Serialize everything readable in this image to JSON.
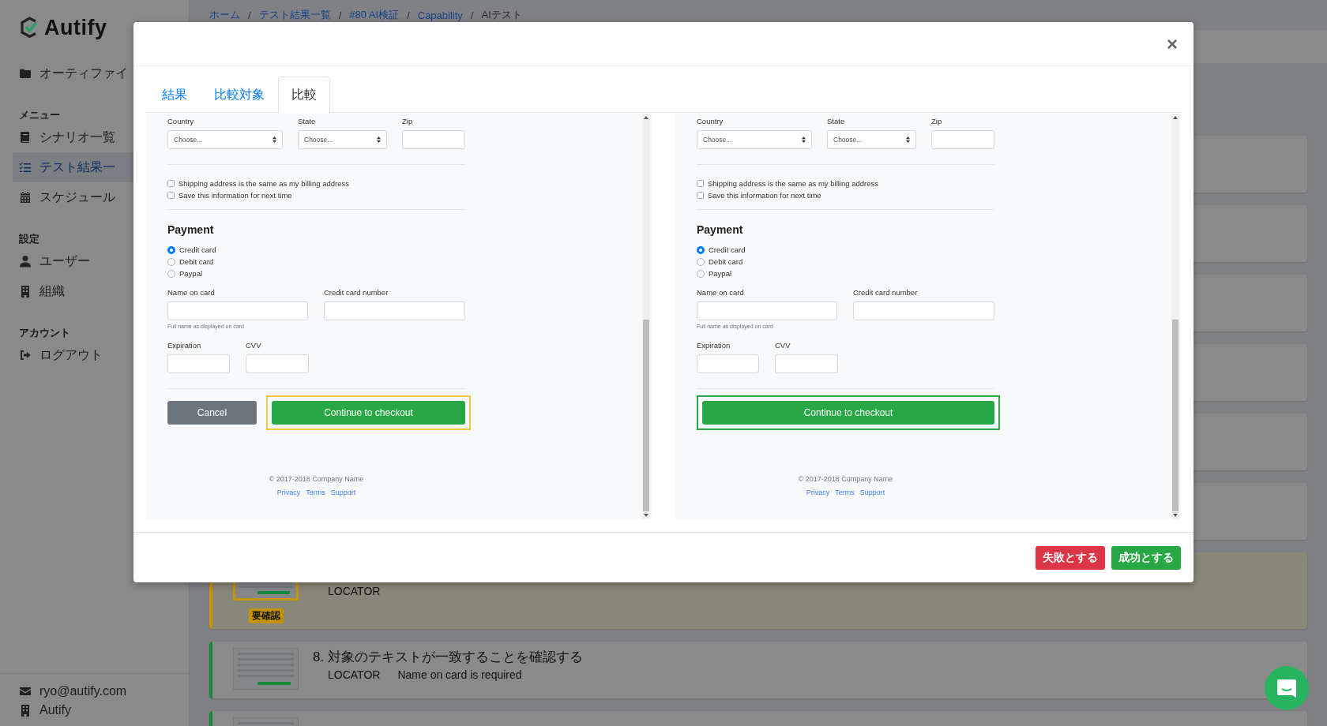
{
  "sidebar": {
    "logo": "Autify",
    "project": "オーティファイ",
    "sections": [
      {
        "heading": "メニュー",
        "items": [
          {
            "label": "シナリオ一覧",
            "selected": false
          },
          {
            "label": "テスト結果一",
            "selected": true
          },
          {
            "label": "スケジュール",
            "selected": false
          }
        ]
      },
      {
        "heading": "設定",
        "items": [
          {
            "label": "ユーザー",
            "selected": false
          },
          {
            "label": "組織",
            "selected": false
          }
        ]
      },
      {
        "heading": "アカウント",
        "items": [
          {
            "label": "ログアウト",
            "selected": false
          }
        ]
      }
    ],
    "user_email": "ryo@autify.com",
    "organization": "Autify"
  },
  "breadcrumb": [
    {
      "label": "ホーム",
      "link": true,
      "separator": "/"
    },
    {
      "label": "テスト結果一覧",
      "link": true,
      "separator": "/"
    },
    {
      "label": "#80 AI検証",
      "link": true,
      "separator": "/"
    },
    {
      "label": "Capability",
      "link": true,
      "separator": "/"
    },
    {
      "label": "AIテスト",
      "link": false
    }
  ],
  "results": [
    {
      "color": "#c49300",
      "badge": "要確認",
      "locator_label": "LOCATOR"
    },
    {
      "color": "#168a3a",
      "title": "8. 対象のテキストが一致することを確認する",
      "locator_label": "LOCATOR",
      "locator_value": "Name on card is required"
    },
    {
      "color": "#168a3a"
    }
  ],
  "modal": {
    "close": "×",
    "tabs": [
      {
        "label": "結果",
        "selected": false
      },
      {
        "label": "比較対象",
        "selected": false
      },
      {
        "label": "比較",
        "selected": true
      }
    ],
    "panels": [
      {
        "address_fields": [
          {
            "label": "Country",
            "kind": "select",
            "value": "Choose..."
          },
          {
            "label": "State",
            "kind": "select",
            "value": "Choose..."
          },
          {
            "label": "Zip",
            "kind": "input"
          }
        ],
        "checkboxes": [
          {
            "label": "Shipping address is the same as my billing address",
            "checked": false
          },
          {
            "label": "Save this information for next time",
            "checked": false
          }
        ],
        "payment_heading": "Payment",
        "payment_methods": [
          {
            "label": "Credit card",
            "selected": true
          },
          {
            "label": "Debit card",
            "selected": false
          },
          {
            "label": "Paypal",
            "selected": false
          }
        ],
        "card_fields": [
          {
            "label": "Name on card",
            "help": "Full name as displayed on card"
          },
          {
            "label": "Credit card number"
          }
        ],
        "expiry_fields": [
          {
            "label": "Expiration"
          },
          {
            "label": "CVV"
          }
        ],
        "buttons": [
          {
            "label": "Cancel",
            "kind": "secondary"
          },
          {
            "label": "Continue to checkout",
            "kind": "success",
            "color": "#f7c544"
          }
        ],
        "copyright": "© 2017-2018 Company Name",
        "links": [
          "Privacy",
          "Terms",
          "Support"
        ]
      },
      {
        "address_fields": [
          {
            "label": "Country",
            "kind": "select",
            "value": "Choose..."
          },
          {
            "label": "State",
            "kind": "select",
            "value": "Choose..."
          },
          {
            "label": "Zip",
            "kind": "input"
          }
        ],
        "checkboxes": [
          {
            "label": "Shipping address is the same as my billing address",
            "checked": false
          },
          {
            "label": "Save this information for next time",
            "checked": false
          }
        ],
        "payment_heading": "Payment",
        "payment_methods": [
          {
            "label": "Credit card",
            "selected": true
          },
          {
            "label": "Debit card",
            "selected": false
          },
          {
            "label": "Paypal",
            "selected": false
          }
        ],
        "card_fields": [
          {
            "label": "Name on card",
            "help": "Full name as displayed on card"
          },
          {
            "label": "Credit card number"
          }
        ],
        "expiry_fields": [
          {
            "label": "Expiration"
          },
          {
            "label": "CVV"
          }
        ],
        "buttons": [
          {
            "label": "Continue to checkout",
            "kind": "success",
            "color": "#28a745"
          }
        ],
        "copyright": "© 2017-2018 Company Name",
        "links": [
          "Privacy",
          "Terms",
          "Support"
        ]
      }
    ],
    "footer_buttons": [
      {
        "label": "失敗とする",
        "kind": "danger"
      },
      {
        "label": "成功とする",
        "kind": "success"
      }
    ]
  }
}
